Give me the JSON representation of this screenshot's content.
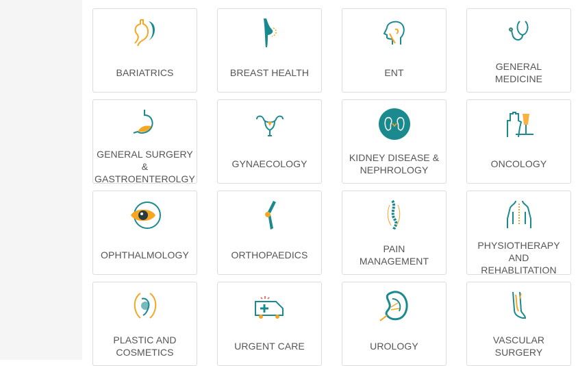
{
  "colors": {
    "teal": "#1b8a8f",
    "orange": "#f5a623",
    "text": "#555555",
    "border": "#dcdcdc"
  },
  "specialties": [
    {
      "label": "BARIATRICS",
      "icon": "stomach-icon"
    },
    {
      "label": "BREAST HEALTH",
      "icon": "breast-icon"
    },
    {
      "label": "ENT",
      "icon": "head-profile-icon"
    },
    {
      "label": "GENERAL\nMEDICINE",
      "icon": "stethoscope-icon"
    },
    {
      "label": "GENERAL SURGERY\n&\nGASTROENTEROLGY",
      "icon": "stomach-surgery-icon"
    },
    {
      "label": "GYNAECOLOGY",
      "icon": "uterus-icon"
    },
    {
      "label": "KIDNEY DISEASE &\nNEPHROLOGY",
      "icon": "kidney-icon"
    },
    {
      "label": "ONCOLOGY",
      "icon": "glove-iv-icon"
    },
    {
      "label": "OPHTHALMOLOGY",
      "icon": "eye-icon"
    },
    {
      "label": "ORTHOPAEDICS",
      "icon": "knee-joint-icon"
    },
    {
      "label": "PAIN\nMANAGEMENT",
      "icon": "spine-icon"
    },
    {
      "label": "PHYSIOTHERAPY\nAND\nREHABLITATION",
      "icon": "body-spine-icon"
    },
    {
      "label": "PLASTIC AND\nCOSMETICS",
      "icon": "face-profile-icon"
    },
    {
      "label": "URGENT CARE",
      "icon": "ambulance-icon"
    },
    {
      "label": "UROLOGY",
      "icon": "kidney-cross-section-icon"
    },
    {
      "label": "VASCULAR\nSURGERY",
      "icon": "leg-veins-icon"
    }
  ]
}
